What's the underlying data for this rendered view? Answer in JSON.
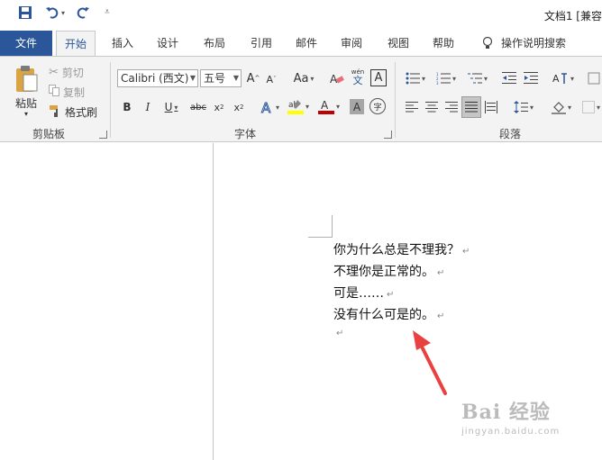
{
  "title": "文档1 [兼容",
  "tabs": [
    "文件",
    "开始",
    "插入",
    "设计",
    "布局",
    "引用",
    "邮件",
    "审阅",
    "视图",
    "帮助"
  ],
  "tell_me": "操作说明搜索",
  "clipboard": {
    "paste": "粘贴",
    "cut": "剪切",
    "copy": "复制",
    "format_painter": "格式刷",
    "group_label": "剪贴板"
  },
  "font": {
    "font_name": "Calibri (西文)",
    "font_size": "五号",
    "case_label": "Aa",
    "phonetic": "wén",
    "group_label": "字体"
  },
  "paragraph": {
    "group_label": "段落"
  },
  "document": {
    "lines": [
      "你为什么总是不理我？",
      "不理你是正常的。",
      "可是……",
      "没有什么可是的。",
      ""
    ],
    "paragraph_mark": "↵"
  },
  "watermark": {
    "main": "Bai 经验",
    "sub": "jingyan.baidu.com"
  },
  "colors": {
    "accent": "#2b579a",
    "highlight": "#ffff00",
    "font_color": "#c00000",
    "arrow": "#e8413f"
  }
}
